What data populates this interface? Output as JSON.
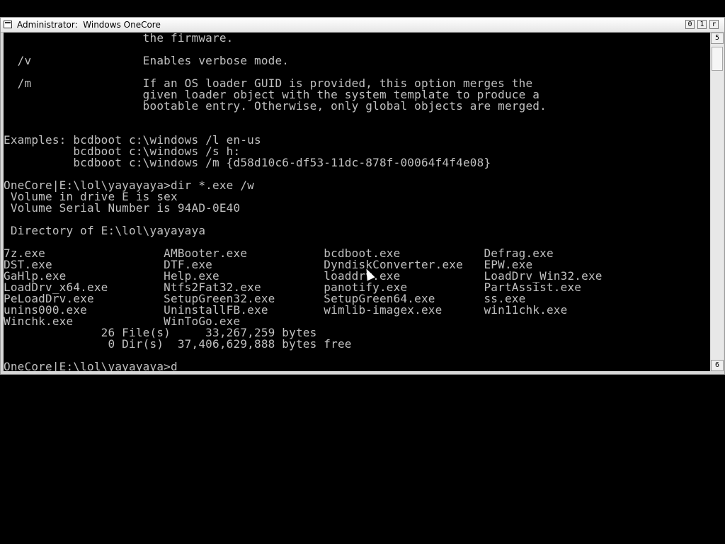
{
  "window": {
    "title": "Administrator:  Windows OneCore",
    "controls": {
      "minimize": "0",
      "maximize": "1",
      "close": "r"
    }
  },
  "scrollbar": {
    "up_glyph": "5",
    "down_glyph": "6"
  },
  "console": {
    "lines": [
      "                    the firmware.",
      "",
      "  /v                Enables verbose mode.",
      "",
      "  /m                If an OS loader GUID is provided, this option merges the",
      "                    given loader object with the system template to produce a",
      "                    bootable entry. Otherwise, only global objects are merged.",
      "",
      "",
      "Examples: bcdboot c:\\windows /l en-us",
      "          bcdboot c:\\windows /s h:",
      "          bcdboot c:\\windows /m {d58d10c6-df53-11dc-878f-00064f4f4e08}",
      "",
      "OneCore|E:\\lol\\yayayaya>dir *.exe /w",
      " Volume in drive E is sex",
      " Volume Serial Number is 94AD-0E40",
      "",
      " Directory of E:\\lol\\yayayaya",
      "",
      "7z.exe                 AMBooter.exe           bcdboot.exe            Defrag.exe",
      "DST.exe                DTF.exe                DyndiskConverter.exe   EPW.exe",
      "GaHlp.exe              Help.exe               loaddrv.exe            LoadDrv_Win32.exe",
      "LoadDrv_x64.exe        Ntfs2Fat32.exe         panotify.exe           PartAssist.exe",
      "PeLoadDrv.exe          SetupGreen32.exe       SetupGreen64.exe       ss.exe",
      "unins000.exe           UninstallFB.exe        wimlib-imagex.exe      win11chk.exe",
      "Winchk.exe             WinToGo.exe",
      "              26 File(s)     33,267,259 bytes",
      "               0 Dir(s)  37,406,629,888 bytes free",
      ""
    ],
    "prompt": "OneCore|E:\\lol\\yayayaya>",
    "input": "d"
  }
}
